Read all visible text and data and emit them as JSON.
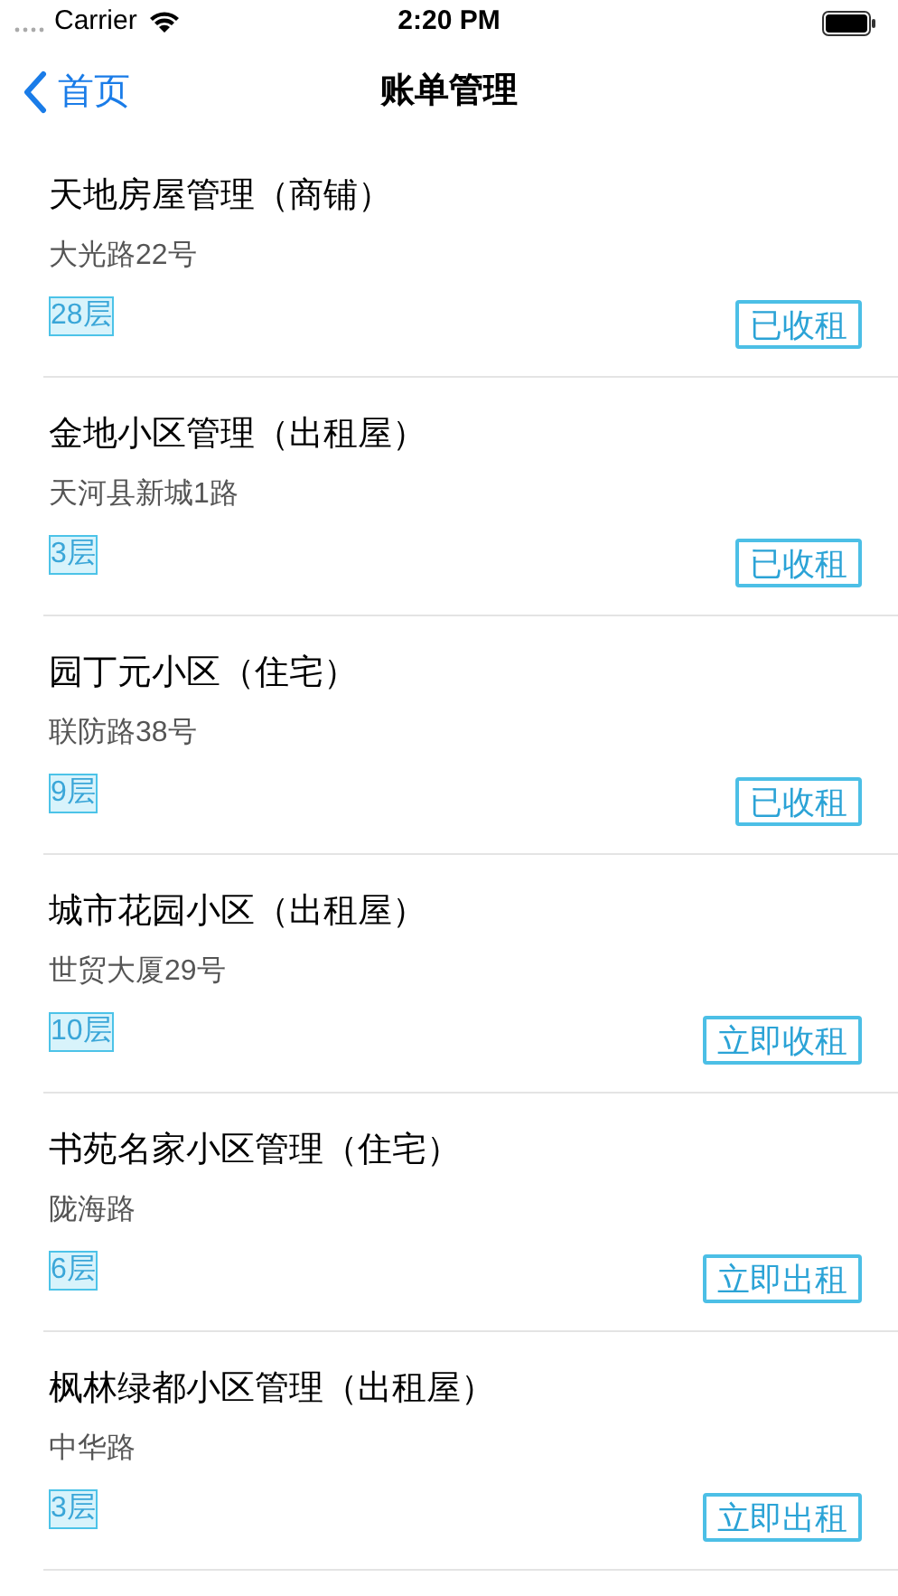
{
  "status_bar": {
    "carrier": "Carrier",
    "time": "2:20 PM"
  },
  "nav": {
    "back": "首页",
    "title": "账单管理"
  },
  "properties": [
    {
      "name": "天地房屋管理（商铺）",
      "address": "大光路22号",
      "floors": "28层",
      "action": "已收租"
    },
    {
      "name": "金地小区管理（出租屋）",
      "address": "天河县新城1路",
      "floors": "3层",
      "action": "已收租"
    },
    {
      "name": "园丁元小区（住宅）",
      "address": "联防路38号",
      "floors": "9层",
      "action": "已收租"
    },
    {
      "name": "城市花园小区（出租屋）",
      "address": "世贸大厦29号",
      "floors": "10层",
      "action": "立即收租"
    },
    {
      "name": "书苑名家小区管理（住宅）",
      "address": "陇海路",
      "floors": "6层",
      "action": "立即出租"
    },
    {
      "name": "枫林绿都小区管理（出租屋）",
      "address": "中华路",
      "floors": "3层",
      "action": "立即出租"
    }
  ]
}
